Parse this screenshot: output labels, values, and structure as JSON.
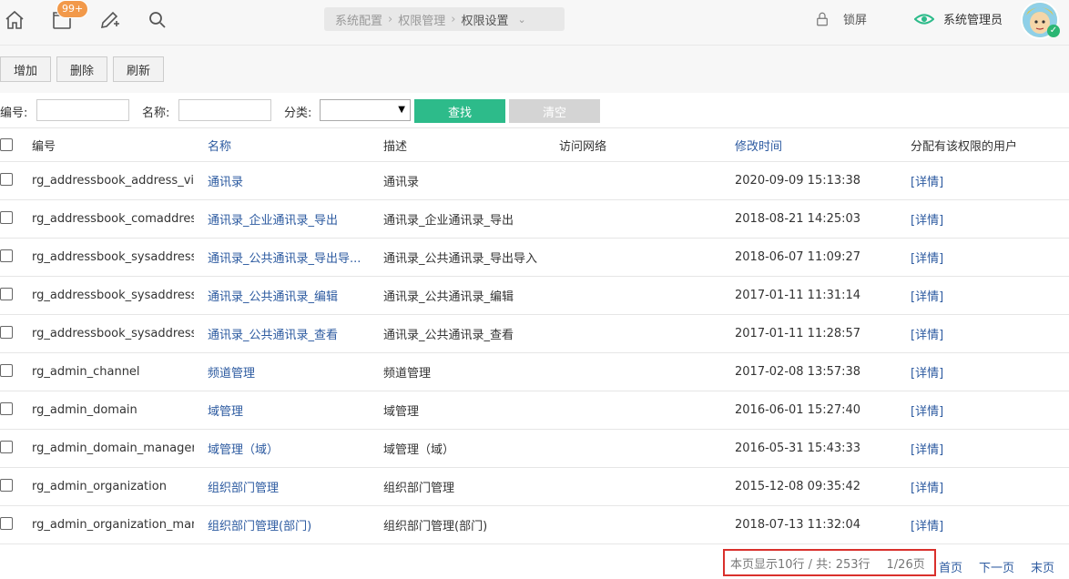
{
  "topbar": {
    "notification_badge": "99+",
    "breadcrumb": [
      "系统配置",
      "权限管理",
      "权限设置"
    ],
    "lock_label": "锁屏",
    "user_label": "系统管理员",
    "accent_color": "#2dbb8a"
  },
  "toolbar": {
    "add_label": "增加",
    "delete_label": "删除",
    "refresh_label": "刷新"
  },
  "filter": {
    "id_label": "编号:",
    "id_value": "",
    "name_label": "名称:",
    "name_value": "",
    "category_label": "分类:",
    "category_value": "",
    "search_label": "查找",
    "clear_label": "清空"
  },
  "table": {
    "headers": {
      "id": "编号",
      "name": "名称",
      "desc": "描述",
      "network": "访问网络",
      "modified": "修改时间",
      "users": "分配有该权限的用户"
    },
    "rows": [
      {
        "id": "rg_addressbook_address_view",
        "name": "通讯录",
        "desc": "通讯录",
        "network": "",
        "modified": "2020-09-09 15:13:38",
        "users": "[详情]"
      },
      {
        "id": "rg_addressbook_comaddres...",
        "name": "通讯录_企业通讯录_导出",
        "desc": "通讯录_企业通讯录_导出",
        "network": "",
        "modified": "2018-08-21 14:25:03",
        "users": "[详情]"
      },
      {
        "id": "rg_addressbook_sysaddress...",
        "name": "通讯录_公共通讯录_导出导...",
        "desc": "通讯录_公共通讯录_导出导入",
        "network": "",
        "modified": "2018-06-07 11:09:27",
        "users": "[详情]"
      },
      {
        "id": "rg_addressbook_sysaddress...",
        "name": "通讯录_公共通讯录_编辑",
        "desc": "通讯录_公共通讯录_编辑",
        "network": "",
        "modified": "2017-01-11 11:31:14",
        "users": "[详情]"
      },
      {
        "id": "rg_addressbook_sysaddress...",
        "name": "通讯录_公共通讯录_查看",
        "desc": "通讯录_公共通讯录_查看",
        "network": "",
        "modified": "2017-01-11 11:28:57",
        "users": "[详情]"
      },
      {
        "id": "rg_admin_channel",
        "name": "频道管理",
        "desc": "频道管理",
        "network": "",
        "modified": "2017-02-08 13:57:38",
        "users": "[详情]"
      },
      {
        "id": "rg_admin_domain",
        "name": "域管理",
        "desc": "域管理",
        "network": "",
        "modified": "2016-06-01 15:27:40",
        "users": "[详情]"
      },
      {
        "id": "rg_admin_domain_manager",
        "name": "域管理（域）",
        "desc": "域管理（域）",
        "network": "",
        "modified": "2016-05-31 15:43:33",
        "users": "[详情]"
      },
      {
        "id": "rg_admin_organization",
        "name": "组织部门管理",
        "desc": "组织部门管理",
        "network": "",
        "modified": "2015-12-08 09:35:42",
        "users": "[详情]"
      },
      {
        "id": "rg_admin_organization_man...",
        "name": "组织部门管理(部门)",
        "desc": "组织部门管理(部门)",
        "network": "",
        "modified": "2018-07-13 11:32:04",
        "users": "[详情]"
      }
    ]
  },
  "pager": {
    "summary": "本页显示10行 / 共: 253行",
    "page": "1/26页",
    "first": "首页",
    "next": "下一页",
    "last": "末页"
  }
}
